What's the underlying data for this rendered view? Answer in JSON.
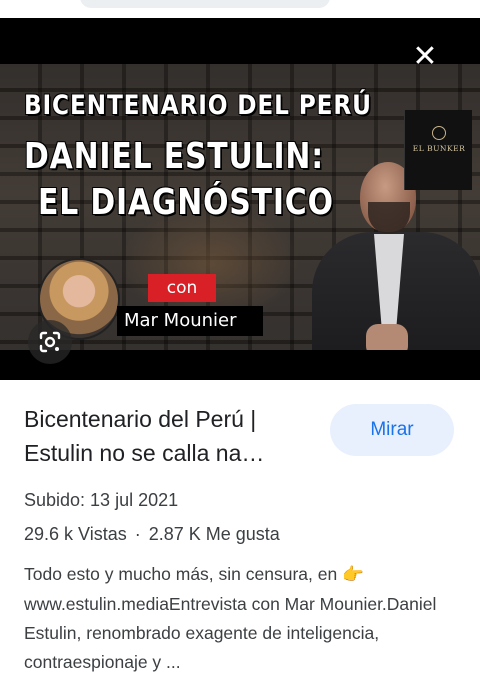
{
  "thumbnail": {
    "title_line1": "BICENTENARIO DEL PERÚ",
    "title_line2": "DANIEL ESTULIN:",
    "title_line3": "EL DIAGNÓSTICO",
    "con_label": "con",
    "guest_name": "Mar Mounier",
    "logo_text": "EL BUNKER"
  },
  "video": {
    "title": "Bicentenario del Perú | Estulin no se calla na…",
    "watch_label": "Mirar",
    "uploaded": "Subido: 13 jul 2021",
    "views": "29.6 k Vistas",
    "separator": "·",
    "likes": "2.87 K Me gusta",
    "description": "Todo esto y mucho más, sin censura, en",
    "pointer_emoji": "👉",
    "description_cont": " www.estulin.mediaEntrevista con Mar Mounier.Daniel Estulin, renombrado exagente de inteligencia, contraespionaje y ..."
  },
  "icons": {
    "close": "✕"
  },
  "colors": {
    "accent": "#1a73e8",
    "button_bg": "#e8f0fe",
    "badge_red": "#d92027"
  }
}
